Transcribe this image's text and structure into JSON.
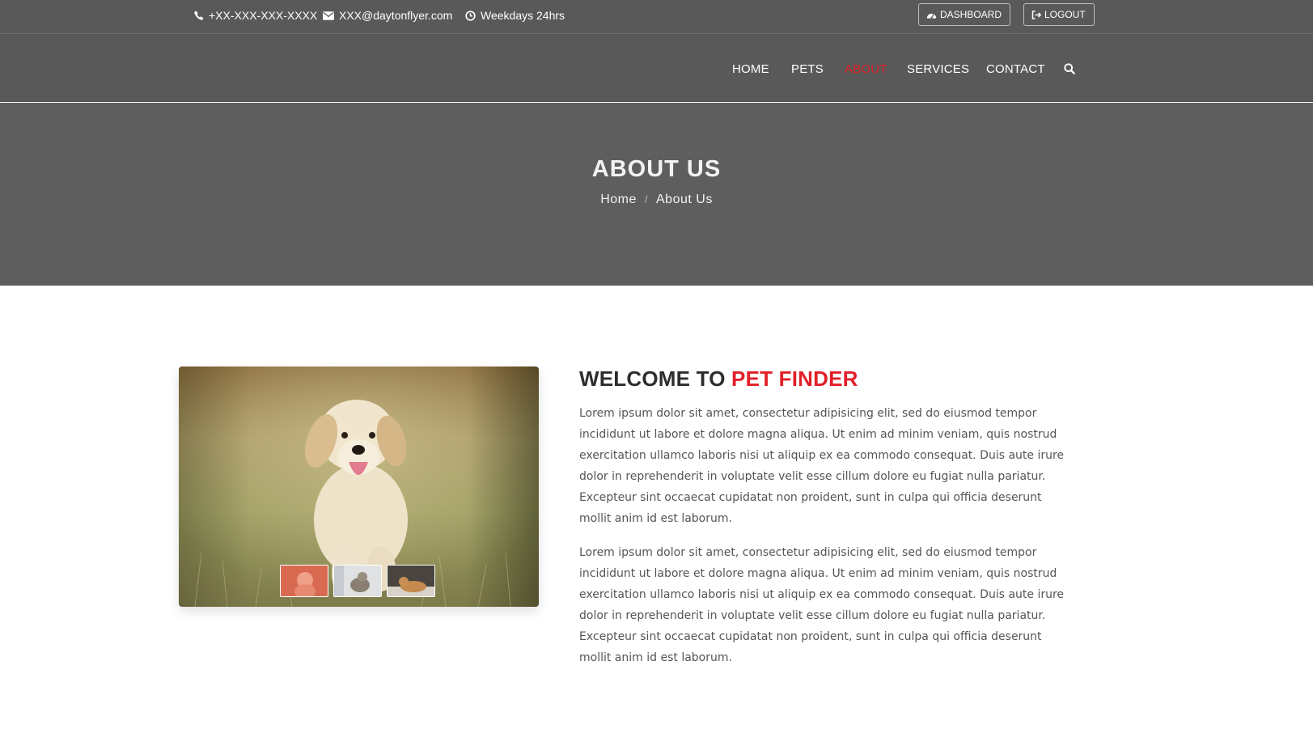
{
  "topbar": {
    "phone": "+XX-XXX-XXX-XXXX",
    "email": "XXX@daytonflyer.com",
    "hours": "Weekdays 24hrs",
    "dashboard_label": "DASHBOARD",
    "logout_label": "LOGOUT"
  },
  "nav": {
    "items": [
      {
        "label": "HOME"
      },
      {
        "label": "PETS"
      },
      {
        "label": "ABOUT"
      },
      {
        "label": "SERVICES"
      },
      {
        "label": "CONTACT"
      }
    ],
    "active_item": "ABOUT",
    "search_icon": "search-icon"
  },
  "hero": {
    "title": "ABOUT US",
    "breadcrumb": {
      "home": "Home",
      "separator": "/",
      "current": "About Us"
    }
  },
  "content": {
    "welcome_prefix": "WELCOME TO ",
    "welcome_highlight": "PET FINDER",
    "paragraphs": [
      "Lorem ipsum dolor sit amet, consectetur adipisicing elit, sed do eiusmod tempor incididunt ut labore et dolore magna aliqua. Ut enim ad minim veniam, quis nostrud exercitation ullamco laboris nisi ut aliquip ex ea commodo consequat. Duis aute irure dolor in reprehenderit in voluptate velit esse cillum dolore eu fugiat nulla pariatur. Excepteur sint occaecat cupidatat non proident, sunt in culpa qui officia deserunt mollit anim id est laborum.",
      "Lorem ipsum dolor sit amet, consectetur adipisicing elit, sed do eiusmod tempor incididunt ut labore et dolore magna aliqua. Ut enim ad minim veniam, quis nostrud exercitation ullamco laboris nisi ut aliquip ex ea commodo consequat. Duis aute irure dolor in reprehenderit in voluptate velit esse cillum dolore eu fugiat nulla pariatur. Excepteur sint occaecat cupidatat non proident, sunt in culpa qui officia deserunt mollit anim id est laborum."
    ],
    "gallery_thumbnails": [
      "dog-thumbnail",
      "cat-thumbnail",
      "cat-lying-thumbnail"
    ]
  },
  "colors": {
    "accent": "#e11f28",
    "header_bg": "#595959",
    "hero_bg": "#5e5e5e",
    "heading": "#2d2d2d",
    "body_text": "#555555"
  }
}
